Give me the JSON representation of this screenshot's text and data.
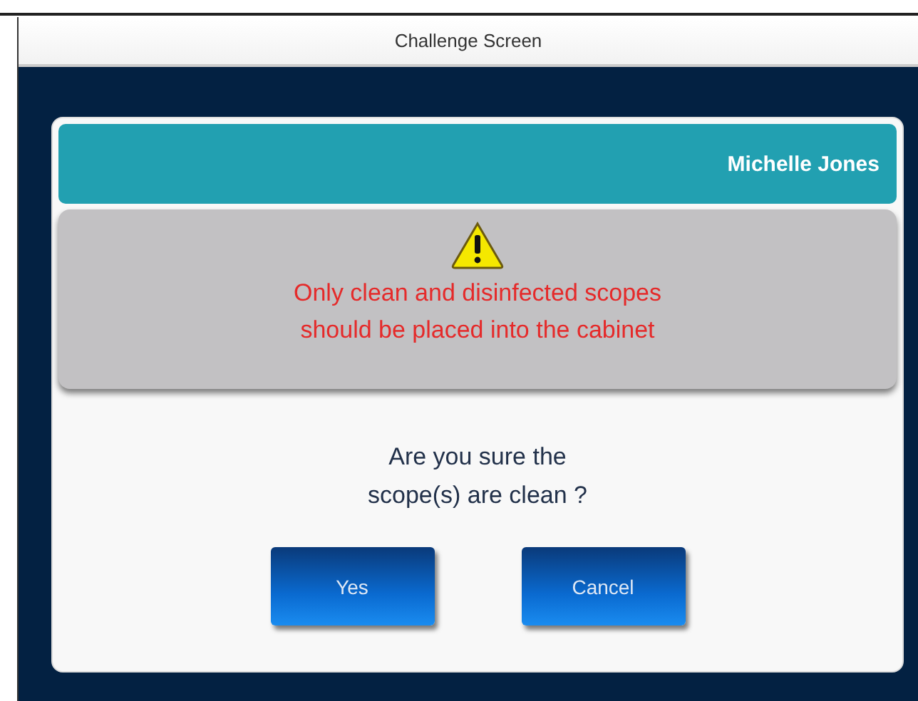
{
  "window": {
    "title": "Challenge Screen"
  },
  "user": {
    "name": "Michelle Jones"
  },
  "warning": {
    "lines": [
      "Only clean and disinfected scopes",
      "should be placed into the cabinet"
    ]
  },
  "question": {
    "lines": [
      "Are you sure the",
      "scope(s) are clean ?"
    ]
  },
  "buttons": [
    "Yes",
    "Cancel"
  ]
}
